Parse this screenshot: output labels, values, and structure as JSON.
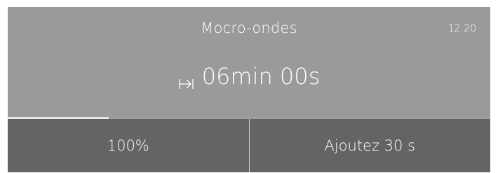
{
  "header": {
    "title": "Mocro-ondes",
    "clock": "12:20"
  },
  "timer": {
    "icon": "timer-end-icon",
    "value": "06min 00s"
  },
  "progress": {
    "fraction": 0.21
  },
  "actions": {
    "power_label": "100%",
    "add_time_label": "Ajoutez 30 s"
  },
  "colors": {
    "panel": "#9a9a9a",
    "buttons": "#646464",
    "text": "#ffffff",
    "progress_fill": "#e6e6e6"
  }
}
